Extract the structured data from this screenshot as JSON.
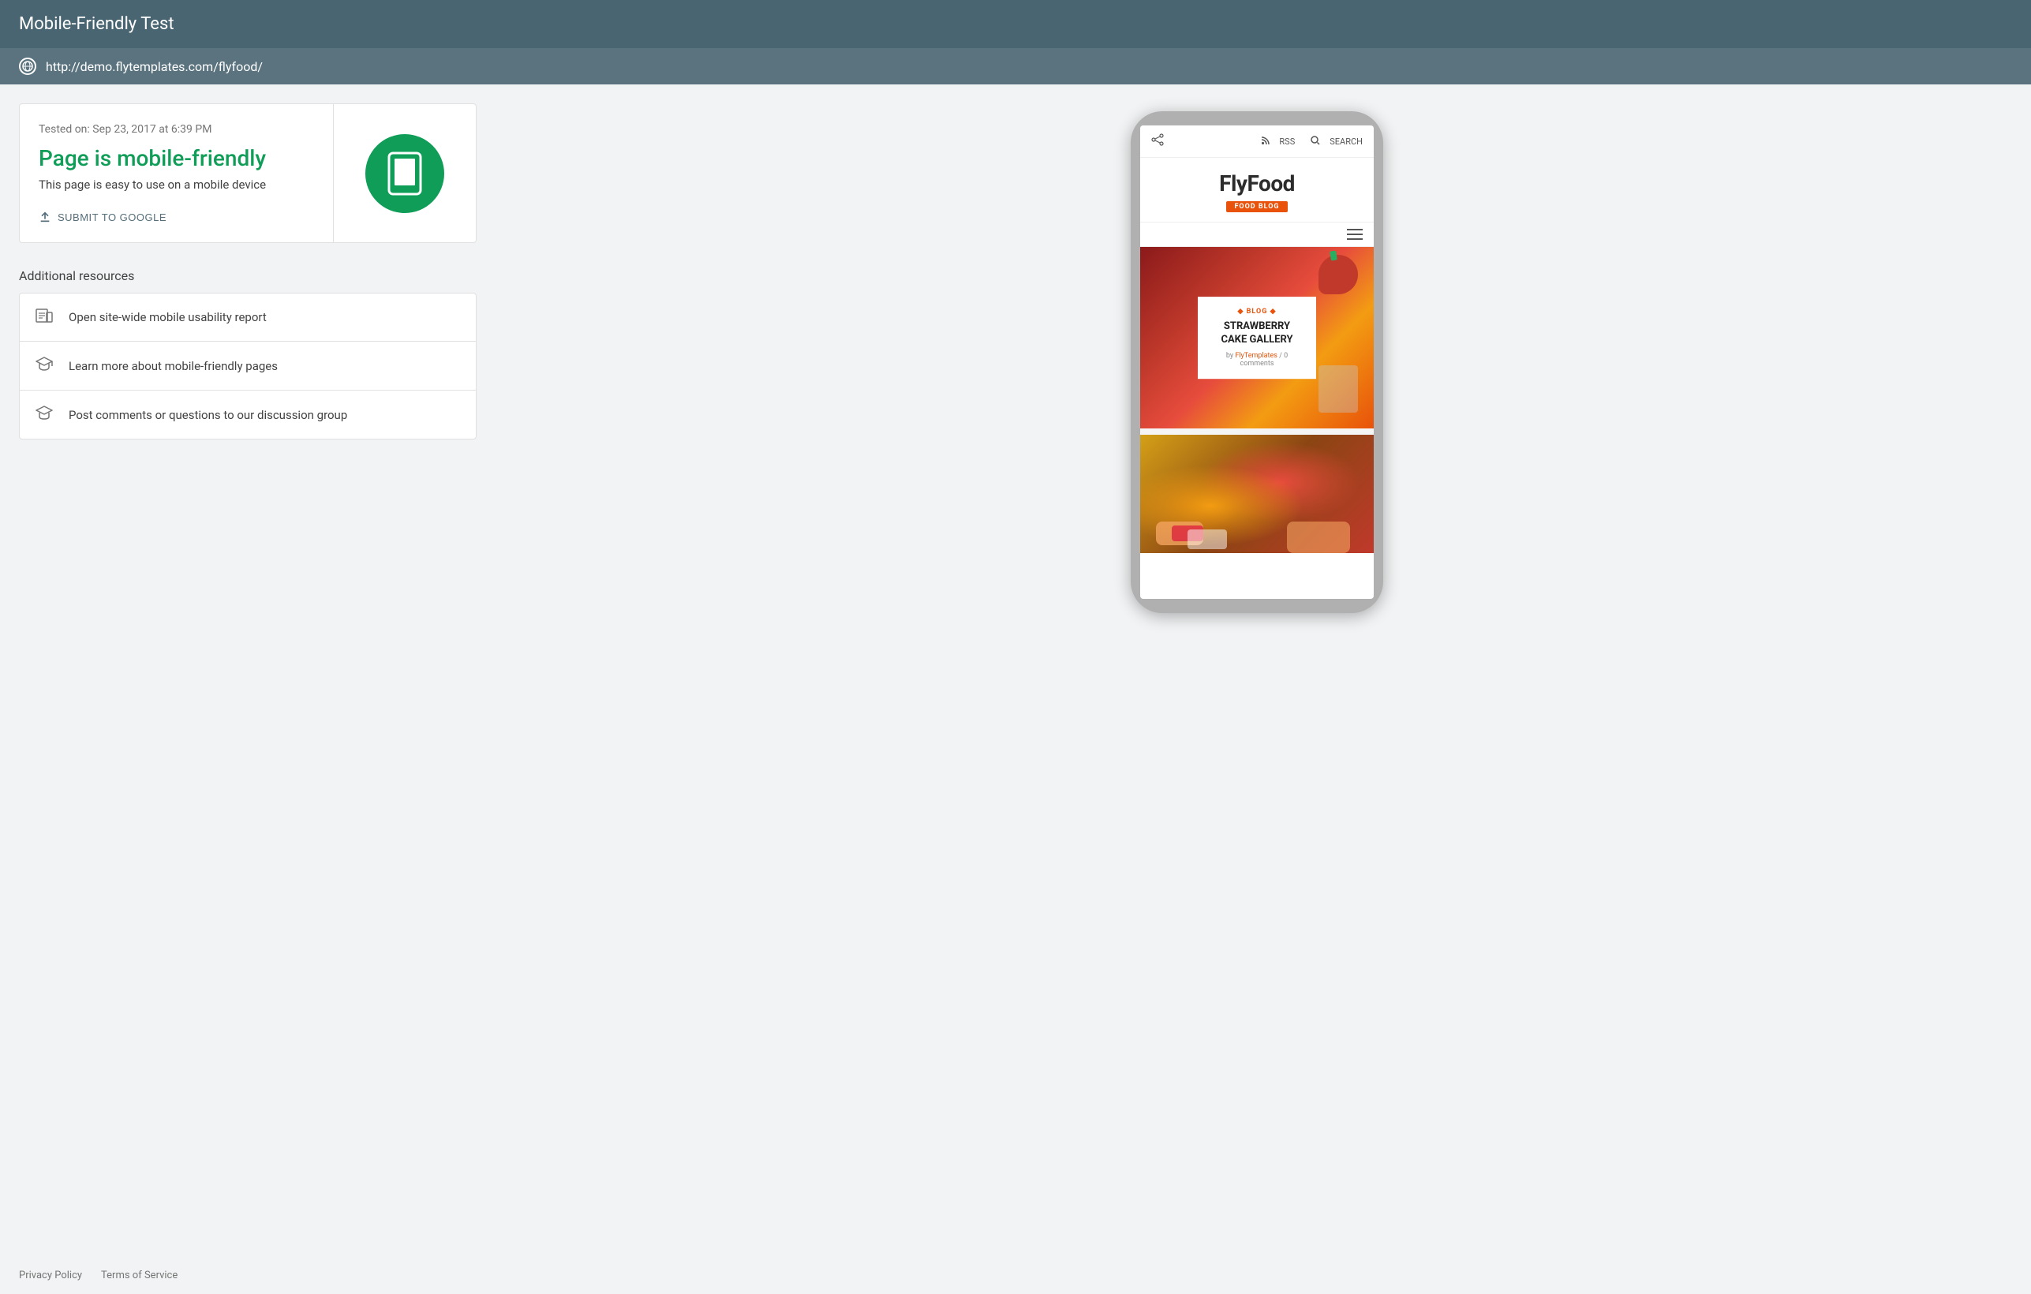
{
  "app": {
    "title": "Mobile-Friendly Test"
  },
  "url_bar": {
    "url": "http://demo.flytemplates.com/flyfood/",
    "globe_label": "globe"
  },
  "result": {
    "tested_on": "Tested on: Sep 23, 2017 at 6:39 PM",
    "status_title": "Page is mobile-friendly",
    "status_desc": "This page is easy to use on a mobile device",
    "submit_label": "SUBMIT TO GOOGLE",
    "phone_icon_label": "mobile-friendly-icon"
  },
  "resources": {
    "heading": "Additional resources",
    "items": [
      {
        "label": "Open site-wide mobile usability report",
        "icon": "report-icon"
      },
      {
        "label": "Learn more about mobile-friendly pages",
        "icon": "learn-icon"
      },
      {
        "label": "Post comments or questions to our discussion group",
        "icon": "discuss-icon"
      }
    ]
  },
  "footer": {
    "privacy": "Privacy Policy",
    "terms": "Terms of Service"
  },
  "phone_preview": {
    "site_name": "FlyFood",
    "site_tagline": "FOOD BLOG",
    "rss_label": "RSS",
    "search_label": "SEARCH",
    "blog_category": "BLOG",
    "blog_title": "STRAWBERRY CAKE GALLERY",
    "blog_meta": "by FlyTemplates / 0 comments"
  }
}
